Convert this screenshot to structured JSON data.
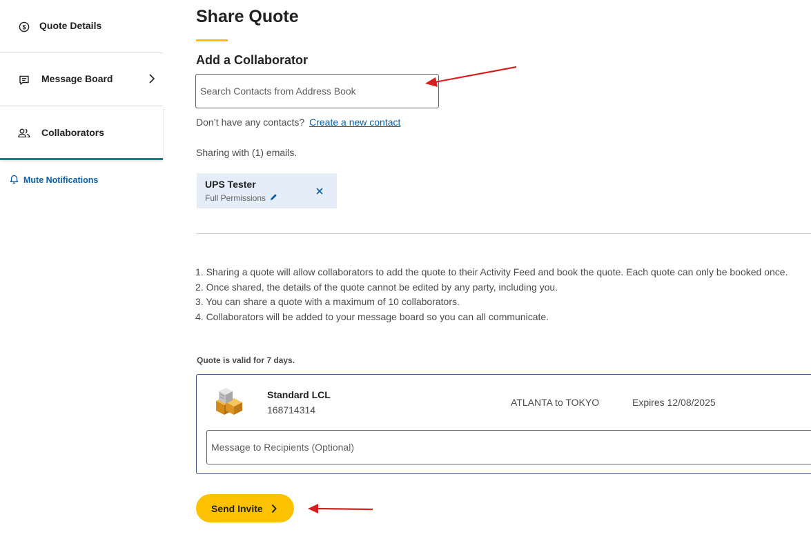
{
  "sidebar": {
    "items": [
      {
        "label": "Quote Details",
        "icon": "dollar-circle-icon"
      },
      {
        "label": "Message Board",
        "icon": "message-icon"
      },
      {
        "label": "Collaborators",
        "icon": "users-icon"
      }
    ],
    "mute_label": "Mute Notifications"
  },
  "main": {
    "title": "Share Quote",
    "subtitle": "Add a Collaborator",
    "search_placeholder": "Search Contacts from Address Book",
    "no_contacts_text": "Don’t have any contacts?",
    "create_contact_link": "Create a new contact",
    "sharing_text": "Sharing with (1) emails.",
    "collaborator": {
      "name": "UPS Tester",
      "permissions": "Full Permissions"
    },
    "notes": [
      "1. Sharing a quote will allow collaborators to add the quote to their Activity Feed and book the quote. Each quote can only be booked once.",
      "2. Once shared, the details of the quote cannot be edited by any party, including you.",
      "3. You can share a quote with a maximum of 10 collaborators.",
      "4. Collaborators will be added to your message board so you can all communicate."
    ],
    "validity": "Quote is valid for 7 days.",
    "quote": {
      "service": "Standard LCL",
      "number": "168714314",
      "route": "ATLANTA to TOKYO",
      "expires": "Expires 12/08/2025",
      "message_placeholder": "Message to Recipients (Optional)"
    },
    "send_label": "Send Invite"
  },
  "colors": {
    "accent_yellow": "#fcc200",
    "link_blue": "#0a5fa8",
    "teal_underline": "#1a7f86",
    "chip_bg": "#e5eef8",
    "annotation_red": "#d42020"
  }
}
